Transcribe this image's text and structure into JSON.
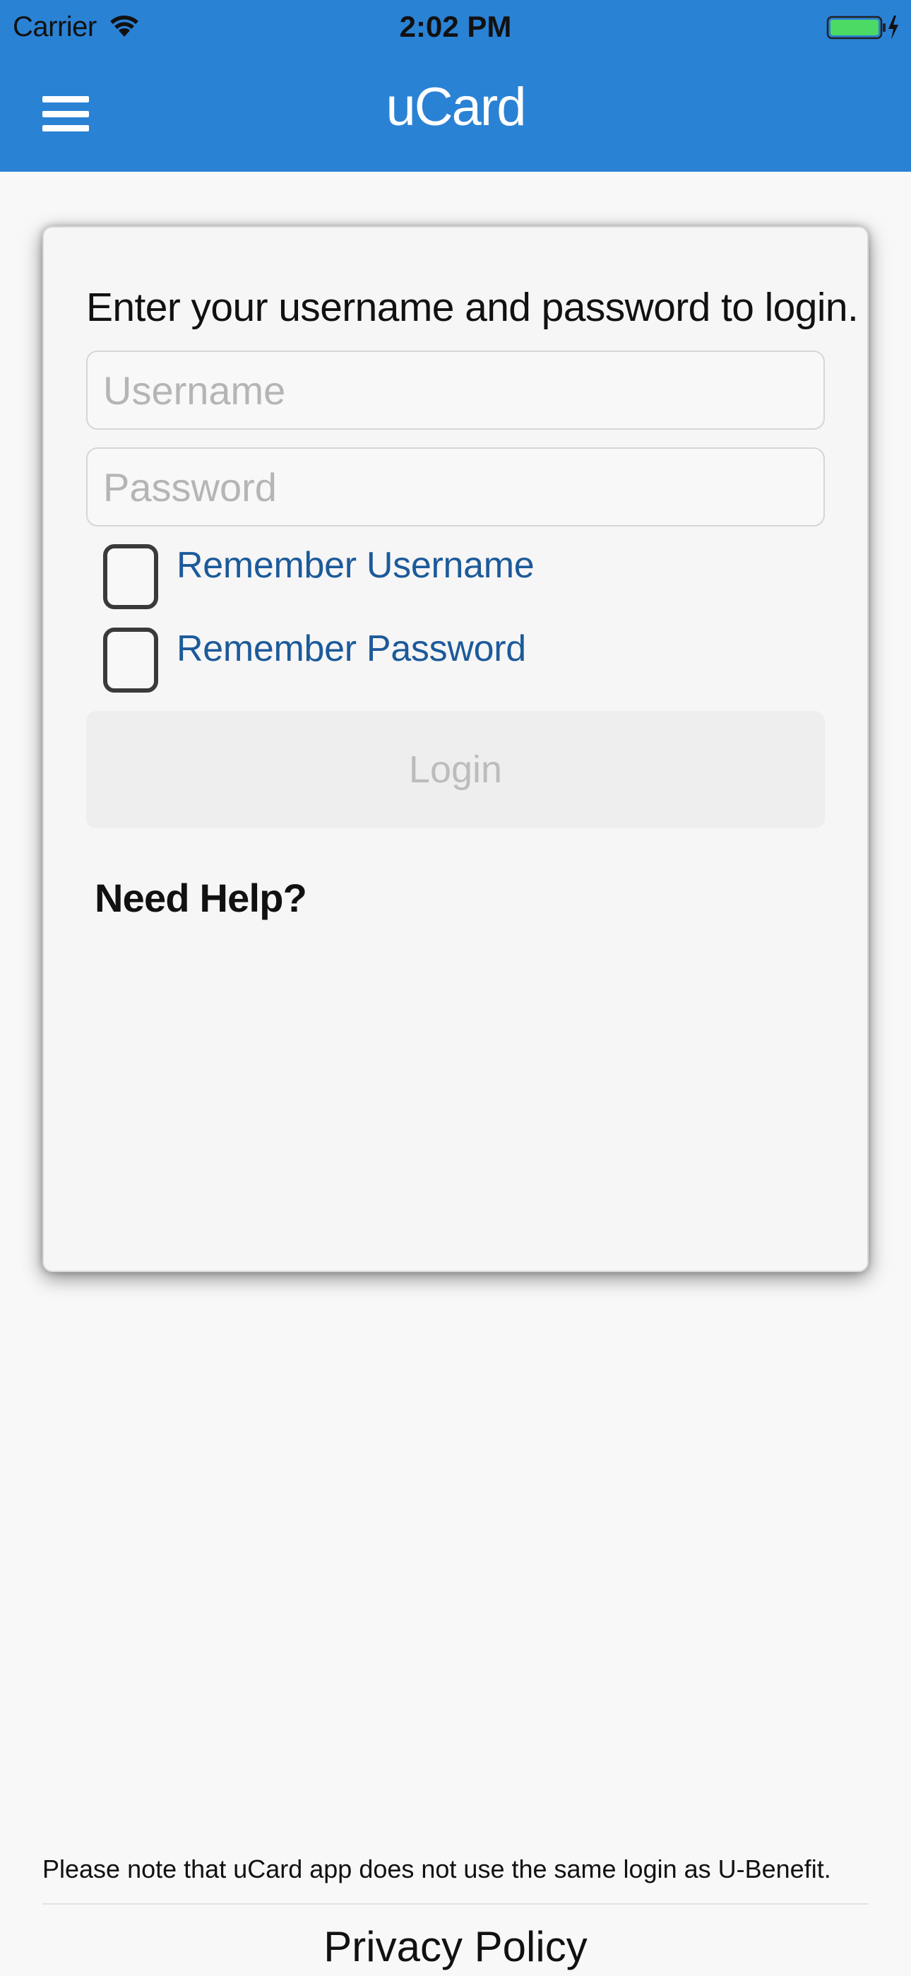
{
  "status_bar": {
    "carrier": "Carrier",
    "time": "2:02 PM",
    "battery_color": "#4cd964"
  },
  "nav": {
    "title": "uCard",
    "menu_icon": "hamburger-menu-icon",
    "background_color": "#2a82d4"
  },
  "login_card": {
    "prompt": "Enter your username and password to login.",
    "username": {
      "value": "",
      "placeholder": "Username"
    },
    "password": {
      "value": "",
      "placeholder": "Password"
    },
    "remember_username": {
      "label": "Remember Username",
      "checked": false
    },
    "remember_password": {
      "label": "Remember Password",
      "checked": false
    },
    "login_label": "Login",
    "help_label": "Need Help?"
  },
  "footer": {
    "note": "Please note that uCard app does not use the same login as U-Benefit.",
    "privacy_label": "Privacy Policy"
  }
}
